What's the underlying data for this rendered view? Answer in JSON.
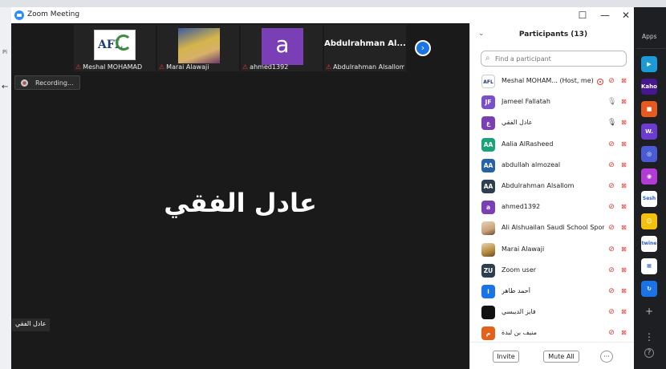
{
  "window": {
    "title": "Zoom Meeting",
    "minimize": "—",
    "maximize": "☐",
    "close": "✕"
  },
  "background": {
    "left_label": "Pi",
    "back_arrow": "←"
  },
  "thumbnails": [
    {
      "name": "Meshal MOHAMAD",
      "muted": true,
      "image": "afl-logo"
    },
    {
      "name": "Marai Alawaji",
      "muted": true,
      "image": "photo"
    },
    {
      "name": "ahmed1392",
      "muted": true,
      "image": "letter",
      "letter": "a"
    },
    {
      "name": "Abdulrahman Alsallom",
      "muted": true,
      "image": "name-only",
      "display": "Abdulrahman  Al..."
    }
  ],
  "afl_logo_text": "AFL",
  "recording": {
    "label": "Recording..."
  },
  "active_speaker": {
    "name": "عادل الفقي",
    "tag": "عادل الفقي"
  },
  "panel": {
    "title": "Participants (13)",
    "search_placeholder": "Find a participant",
    "participants": [
      {
        "initials": "",
        "name": "Meshal MOHAM...",
        "suffix": "(Host, me)",
        "avatar_color": "#ffffff",
        "avatar": "afl",
        "recording": true,
        "mic": "off",
        "cam": "off",
        "rtl": false
      },
      {
        "initials": "JF",
        "name": "Jameel Fallatah",
        "avatar_color": "#7b4fc9",
        "mic": "on",
        "cam": "off",
        "rtl": false
      },
      {
        "initials": "ع",
        "name": "عادل الفقي",
        "avatar_color": "#7a3fb5",
        "mic": "speaking",
        "cam": "off",
        "rtl": false
      },
      {
        "initials": "AA",
        "name": "Aalia AlRasheed",
        "avatar_color": "#1aa37a",
        "mic": "off",
        "cam": "off",
        "rtl": false
      },
      {
        "initials": "AA",
        "name": "abdullah almozeal",
        "avatar_color": "#2563a6",
        "mic": "off",
        "cam": "off",
        "rtl": false
      },
      {
        "initials": "AA",
        "name": "Abdulrahman Alsallom",
        "avatar_color": "#2d3e50",
        "mic": "off",
        "cam": "off",
        "rtl": false
      },
      {
        "initials": "a",
        "name": "ahmed1392",
        "avatar_color": "#7a3fb5",
        "mic": "off",
        "cam": "off",
        "rtl": false
      },
      {
        "initials": "",
        "name": "Ali Alshuailan Saudi School Spor...",
        "avatar_color": "#c9a27a",
        "avatar": "photo",
        "mic": "off",
        "cam": "off",
        "rtl": false
      },
      {
        "initials": "",
        "name": "Marai Alawaji",
        "avatar_color": "#b58a3a",
        "avatar": "photo",
        "mic": "off",
        "cam": "off",
        "rtl": false
      },
      {
        "initials": "ZU",
        "name": "Zoom user",
        "avatar_color": "#2d3e50",
        "mic": "off",
        "cam": "off",
        "rtl": false
      },
      {
        "initials": "ا",
        "name": "أحمد طاهر",
        "avatar_color": "#1a74e8",
        "mic": "off",
        "cam": "off",
        "rtl": false
      },
      {
        "initials": "",
        "name": "فايز الديبسي",
        "avatar_color": "#111111",
        "mic": "off",
        "cam": "off",
        "rtl": false
      },
      {
        "initials": "م",
        "name": "منيف بن لبدة",
        "avatar_color": "#e2621b",
        "mic": "off",
        "cam": "off",
        "rtl": false
      }
    ],
    "invite_label": "Invite",
    "mute_all_label": "Mute All",
    "more_label": "···"
  },
  "apps_rail": {
    "title": "Apps",
    "apps": [
      {
        "name": "app-1",
        "label": "▶",
        "color": "#1c9ad6"
      },
      {
        "name": "kahoot",
        "label": "Kahoot!",
        "color": "#46178f"
      },
      {
        "name": "app-3",
        "label": "■",
        "color": "#e55b1f"
      },
      {
        "name": "wooclap",
        "label": "W.",
        "color": "#6c3cd0"
      },
      {
        "name": "app-5",
        "label": "◎",
        "color": "#4b5bd6"
      },
      {
        "name": "app-6",
        "label": "◉",
        "color": "#b23bd6"
      },
      {
        "name": "sesh",
        "label": "Sesh",
        "color": "#ffffff"
      },
      {
        "name": "app-8",
        "label": "☺",
        "color": "#f4c20d"
      },
      {
        "name": "twine",
        "label": "twine",
        "color": "#ffffff"
      },
      {
        "name": "app-10",
        "label": "▦",
        "color": "#ffffff"
      },
      {
        "name": "app-11",
        "label": "↻",
        "color": "#1a74e8"
      }
    ],
    "add": "+",
    "more": "⋮",
    "help": "?"
  }
}
